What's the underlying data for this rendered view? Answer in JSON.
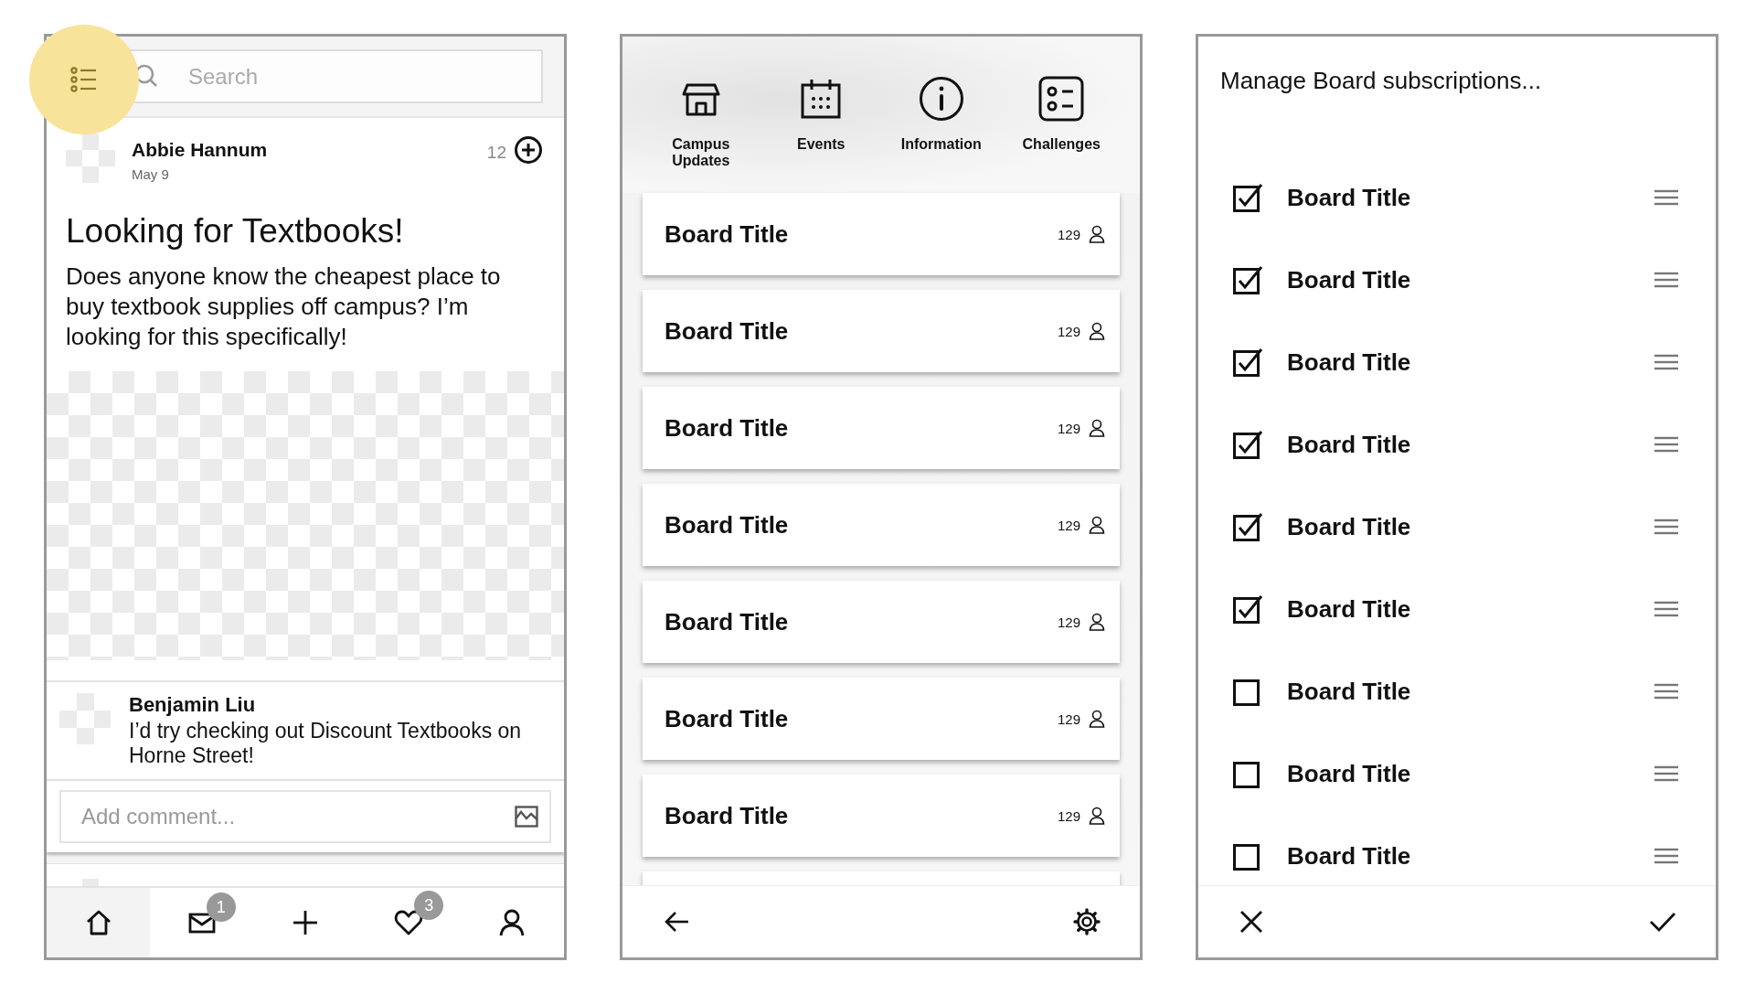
{
  "feed_screen": {
    "menu_button": {
      "highlighted": true
    },
    "search": {
      "placeholder": "Search"
    },
    "post": {
      "author": "Abbie Hannum",
      "date": "May 9",
      "count": "12",
      "title": "Looking for Textbooks!",
      "body": "Does anyone know the cheapest place to buy textbook supplies off campus? I’m looking for this specifically!"
    },
    "comment": {
      "author": "Benjamin Liu",
      "text": "I’d try checking out Discount Textbooks on Horne Street!"
    },
    "comment_field": {
      "placeholder": "Add comment..."
    },
    "nav": [
      {
        "kind": "home",
        "selected": true
      },
      {
        "kind": "mail",
        "selected": false,
        "badge": "1"
      },
      {
        "kind": "add",
        "selected": false
      },
      {
        "kind": "heart",
        "selected": false,
        "badge": "3"
      },
      {
        "kind": "profile",
        "selected": false
      }
    ]
  },
  "boards_screen": {
    "categories": [
      {
        "kind": "store",
        "label": "Campus Updates"
      },
      {
        "kind": "calendar",
        "label": "Events"
      },
      {
        "kind": "info",
        "label": "Information"
      },
      {
        "kind": "checklist",
        "label": "Challenges"
      }
    ],
    "boards": [
      {
        "title": "Board Title",
        "count": "129"
      },
      {
        "title": "Board Title",
        "count": "129"
      },
      {
        "title": "Board Title",
        "count": "129"
      },
      {
        "title": "Board Title",
        "count": "129"
      },
      {
        "title": "Board Title",
        "count": "129"
      },
      {
        "title": "Board Title",
        "count": "129"
      },
      {
        "title": "Board Title",
        "count": "129"
      }
    ]
  },
  "subscriptions_screen": {
    "title": "Manage Board subscriptions...",
    "boards": [
      {
        "title": "Board Title",
        "checked": true
      },
      {
        "title": "Board Title",
        "checked": true
      },
      {
        "title": "Board Title",
        "checked": true
      },
      {
        "title": "Board Title",
        "checked": true
      },
      {
        "title": "Board Title",
        "checked": true
      },
      {
        "title": "Board Title",
        "checked": true
      },
      {
        "title": "Board Title",
        "checked": false
      },
      {
        "title": "Board Title",
        "checked": false
      },
      {
        "title": "Board Title",
        "checked": false
      }
    ]
  }
}
